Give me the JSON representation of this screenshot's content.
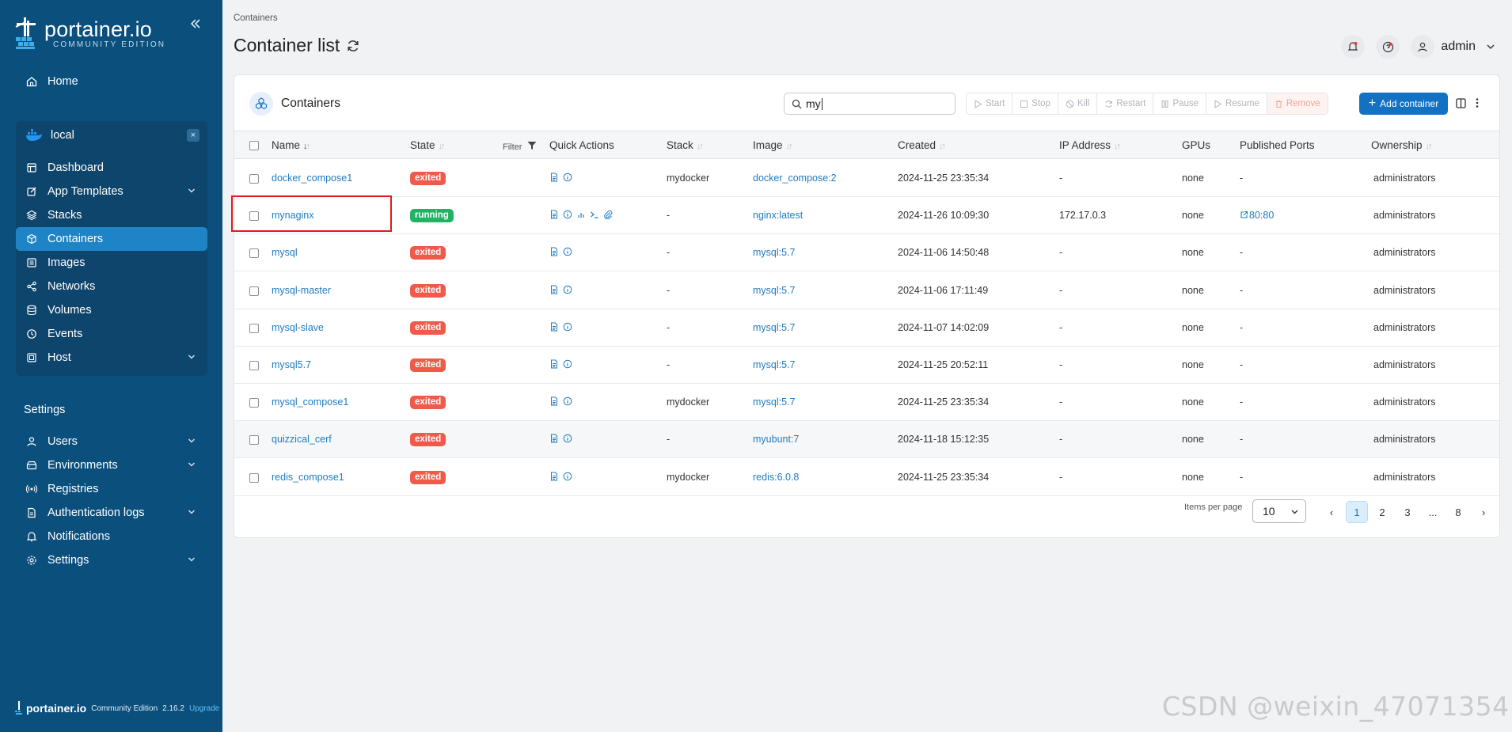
{
  "sidebar": {
    "logo": {
      "name": "portainer.io",
      "edition": "COMMUNITY EDITION"
    },
    "home_label": "Home",
    "environment": {
      "name": "local",
      "close_label": "×"
    },
    "env_items": [
      {
        "label": "Dashboard",
        "icon": "dashboard-icon",
        "expandable": false
      },
      {
        "label": "App Templates",
        "icon": "edit-icon",
        "expandable": true
      },
      {
        "label": "Stacks",
        "icon": "layers-icon",
        "expandable": false
      },
      {
        "label": "Containers",
        "icon": "cube-icon",
        "expandable": false,
        "active": true
      },
      {
        "label": "Images",
        "icon": "list-icon",
        "expandable": false
      },
      {
        "label": "Networks",
        "icon": "share-icon",
        "expandable": false
      },
      {
        "label": "Volumes",
        "icon": "database-icon",
        "expandable": false
      },
      {
        "label": "Events",
        "icon": "history-icon",
        "expandable": false
      },
      {
        "label": "Host",
        "icon": "host-icon",
        "expandable": true
      }
    ],
    "settings_title": "Settings",
    "settings_items": [
      {
        "label": "Users",
        "icon": "user-icon",
        "expandable": true
      },
      {
        "label": "Environments",
        "icon": "hdd-icon",
        "expandable": true
      },
      {
        "label": "Registries",
        "icon": "radio-icon",
        "expandable": false
      },
      {
        "label": "Authentication logs",
        "icon": "file-icon",
        "expandable": true
      },
      {
        "label": "Notifications",
        "icon": "bell-icon",
        "expandable": false
      },
      {
        "label": "Settings",
        "icon": "gear-icon",
        "expandable": true
      }
    ],
    "footer": {
      "logo": "portainer.io",
      "edition": "Community Edition",
      "version": "2.16.2",
      "upgrade": "Upgrade"
    }
  },
  "header": {
    "breadcrumb": "Containers",
    "title": "Container list",
    "user": "admin"
  },
  "card": {
    "title": "Containers",
    "search_value": "my",
    "actions": [
      "Start",
      "Stop",
      "Kill",
      "Restart",
      "Pause",
      "Resume",
      "Remove"
    ],
    "add_label": "Add container",
    "columns": {
      "name": "Name",
      "state": "State",
      "filter": "Filter",
      "quick": "Quick Actions",
      "stack": "Stack",
      "image": "Image",
      "created": "Created",
      "ip": "IP Address",
      "gpus": "GPUs",
      "ports": "Published Ports",
      "owner": "Ownership"
    },
    "rows": [
      {
        "name": "docker_compose1",
        "state": "exited",
        "stack": "mydocker",
        "image": "docker_compose:2",
        "created": "2024-11-25 23:35:34",
        "ip": "-",
        "gpus": "none",
        "ports": "-",
        "owner": "administrators",
        "running": false
      },
      {
        "name": "mynaginx",
        "state": "running",
        "stack": "-",
        "image": "nginx:latest",
        "created": "2024-11-26 10:09:30",
        "ip": "172.17.0.3",
        "gpus": "none",
        "ports": "80:80",
        "owner": "administrators",
        "running": true
      },
      {
        "name": "mysql",
        "state": "exited",
        "stack": "-",
        "image": "mysql:5.7",
        "created": "2024-11-06 14:50:48",
        "ip": "-",
        "gpus": "none",
        "ports": "-",
        "owner": "administrators",
        "running": false
      },
      {
        "name": "mysql-master",
        "state": "exited",
        "stack": "-",
        "image": "mysql:5.7",
        "created": "2024-11-06 17:11:49",
        "ip": "-",
        "gpus": "none",
        "ports": "-",
        "owner": "administrators",
        "running": false
      },
      {
        "name": "mysql-slave",
        "state": "exited",
        "stack": "-",
        "image": "mysql:5.7",
        "created": "2024-11-07 14:02:09",
        "ip": "-",
        "gpus": "none",
        "ports": "-",
        "owner": "administrators",
        "running": false
      },
      {
        "name": "mysql5.7",
        "state": "exited",
        "stack": "-",
        "image": "mysql:5.7",
        "created": "2024-11-25 20:52:11",
        "ip": "-",
        "gpus": "none",
        "ports": "-",
        "owner": "administrators",
        "running": false
      },
      {
        "name": "mysql_compose1",
        "state": "exited",
        "stack": "mydocker",
        "image": "mysql:5.7",
        "created": "2024-11-25 23:35:34",
        "ip": "-",
        "gpus": "none",
        "ports": "-",
        "owner": "administrators",
        "running": false
      },
      {
        "name": "quizzical_cerf",
        "state": "exited",
        "stack": "-",
        "image": "myubunt:7",
        "created": "2024-11-18 15:12:35",
        "ip": "-",
        "gpus": "none",
        "ports": "-",
        "owner": "administrators",
        "running": false
      },
      {
        "name": "redis_compose1",
        "state": "exited",
        "stack": "mydocker",
        "image": "redis:6.0.8",
        "created": "2024-11-25 23:35:34",
        "ip": "-",
        "gpus": "none",
        "ports": "-",
        "owner": "administrators",
        "running": false
      }
    ],
    "footer": {
      "items_per_page_label": "Items per page",
      "items_per_page": "10",
      "pages": [
        "‹",
        "1",
        "2",
        "3",
        "...",
        "8",
        "›"
      ],
      "current_page": "1"
    }
  },
  "watermark": "CSDN @weixin_47071354",
  "colors": {
    "sidebar": "#0b4f7d",
    "active": "#1f84c5",
    "accent": "#1371c4",
    "exited": "#ef5a4b",
    "running": "#21b264",
    "highlight_box": "#e21a1a"
  }
}
